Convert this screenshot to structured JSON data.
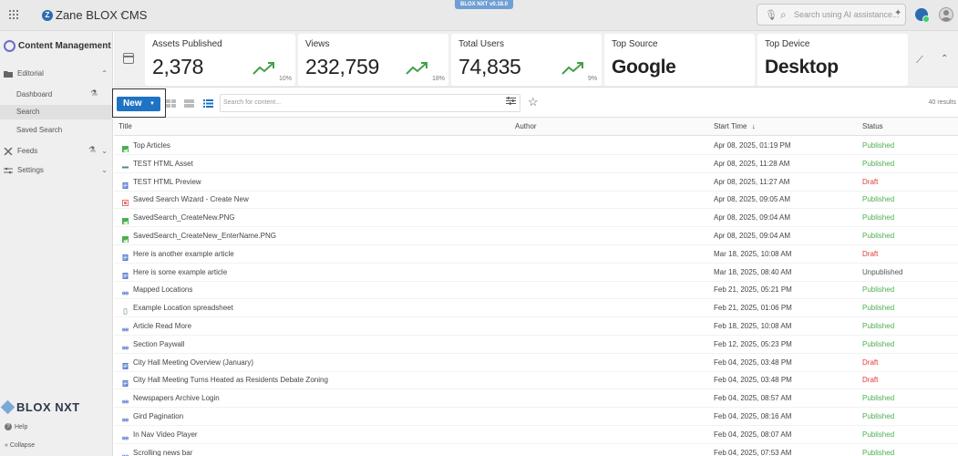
{
  "topbar": {
    "site_logo_letter": "Z",
    "site_name": "Zane BLOX CMS",
    "version_badge": "BLOX NXT v0.18.0",
    "ai_search_placeholder": "Search using AI assistance...",
    "icons": [
      "apps-icon",
      "chevron-down-icon",
      "microphone-icon",
      "search-icon",
      "sparkle-icon",
      "globe-icon",
      "profile-icon"
    ]
  },
  "sidebar": {
    "brand": "Content Management",
    "editorial": "Editorial",
    "items": [
      {
        "label": "Dashboard"
      },
      {
        "label": "Search",
        "active": true
      },
      {
        "label": "Saved Search"
      }
    ],
    "feeds": "Feeds",
    "settings": "Settings",
    "footer_logo": "BLOX NXT",
    "help": "Help",
    "collapse": "Collapse"
  },
  "stats": [
    {
      "label": "Assets Published",
      "value": "2,378",
      "pct": "10%",
      "trend": "up"
    },
    {
      "label": "Views",
      "value": "232,759",
      "pct": "18%",
      "trend": "up"
    },
    {
      "label": "Total Users",
      "value": "74,835",
      "pct": "9%",
      "trend": "up"
    },
    {
      "label": "Top Source",
      "value": "Google"
    },
    {
      "label": "Top Device",
      "value": "Desktop"
    }
  ],
  "toolbar": {
    "new_label": "New",
    "search_placeholder": "Search for content...",
    "results": "40 results"
  },
  "table": {
    "headers": {
      "title": "Title",
      "author": "Author",
      "start_time": "Start Time",
      "status": "Status"
    },
    "rows": [
      {
        "icon": "image",
        "title": "Top Articles",
        "date": "Apr 08, 2025, 01:19 PM",
        "status": "Published"
      },
      {
        "icon": "html",
        "title": "TEST HTML Asset",
        "date": "Apr 08, 2025, 11:28 AM",
        "status": "Published"
      },
      {
        "icon": "article",
        "title": "TEST HTML Preview",
        "date": "Apr 08, 2025, 11:27 AM",
        "status": "Draft"
      },
      {
        "icon": "collection",
        "title": "Saved Search Wizard - Create New",
        "date": "Apr 08, 2025, 09:05 AM",
        "status": "Published"
      },
      {
        "icon": "image",
        "title": "SavedSearch_CreateNew.PNG",
        "date": "Apr 08, 2025, 09:04 AM",
        "status": "Published"
      },
      {
        "icon": "image",
        "title": "SavedSearch_CreateNew_EnterName.PNG",
        "date": "Apr 08, 2025, 09:04 AM",
        "status": "Published"
      },
      {
        "icon": "article",
        "title": "Here is another example article",
        "date": "Mar 18, 2025, 10:08 AM",
        "status": "Draft"
      },
      {
        "icon": "article",
        "title": "Here is some example article",
        "date": "Mar 18, 2025, 08:40 AM",
        "status": "Unpublished"
      },
      {
        "icon": "link",
        "title": "Mapped Locations",
        "date": "Feb 21, 2025, 05:21 PM",
        "status": "Published"
      },
      {
        "icon": "file",
        "title": "Example Location spreadsheet",
        "date": "Feb 21, 2025, 01:06 PM",
        "status": "Published"
      },
      {
        "icon": "link",
        "title": "Article Read More",
        "date": "Feb 18, 2025, 10:08 AM",
        "status": "Published"
      },
      {
        "icon": "link",
        "title": "Section Paywall",
        "date": "Feb 12, 2025, 05:23 PM",
        "status": "Published"
      },
      {
        "icon": "article",
        "title": "City Hall Meeting Overview (January)",
        "date": "Feb 04, 2025, 03:48 PM",
        "status": "Draft"
      },
      {
        "icon": "article",
        "title": "City Hall Meeting Turns Heated as Residents Debate Zoning",
        "date": "Feb 04, 2025, 03:48 PM",
        "status": "Draft"
      },
      {
        "icon": "link",
        "title": "Newspapers Archive Login",
        "date": "Feb 04, 2025, 08:57 AM",
        "status": "Published"
      },
      {
        "icon": "link",
        "title": "Gird Pagination",
        "date": "Feb 04, 2025, 08:16 AM",
        "status": "Published"
      },
      {
        "icon": "link",
        "title": "In Nav Video Player",
        "date": "Feb 04, 2025, 08:07 AM",
        "status": "Published"
      },
      {
        "icon": "link",
        "title": "Scrolling news bar",
        "date": "Feb 04, 2025, 07:53 AM",
        "status": "Published"
      }
    ]
  },
  "colors": {
    "accent": "#1f73c4",
    "published": "#4caf50",
    "draft": "#e53935",
    "unpublished": "#555555",
    "trend": "#43a047"
  }
}
